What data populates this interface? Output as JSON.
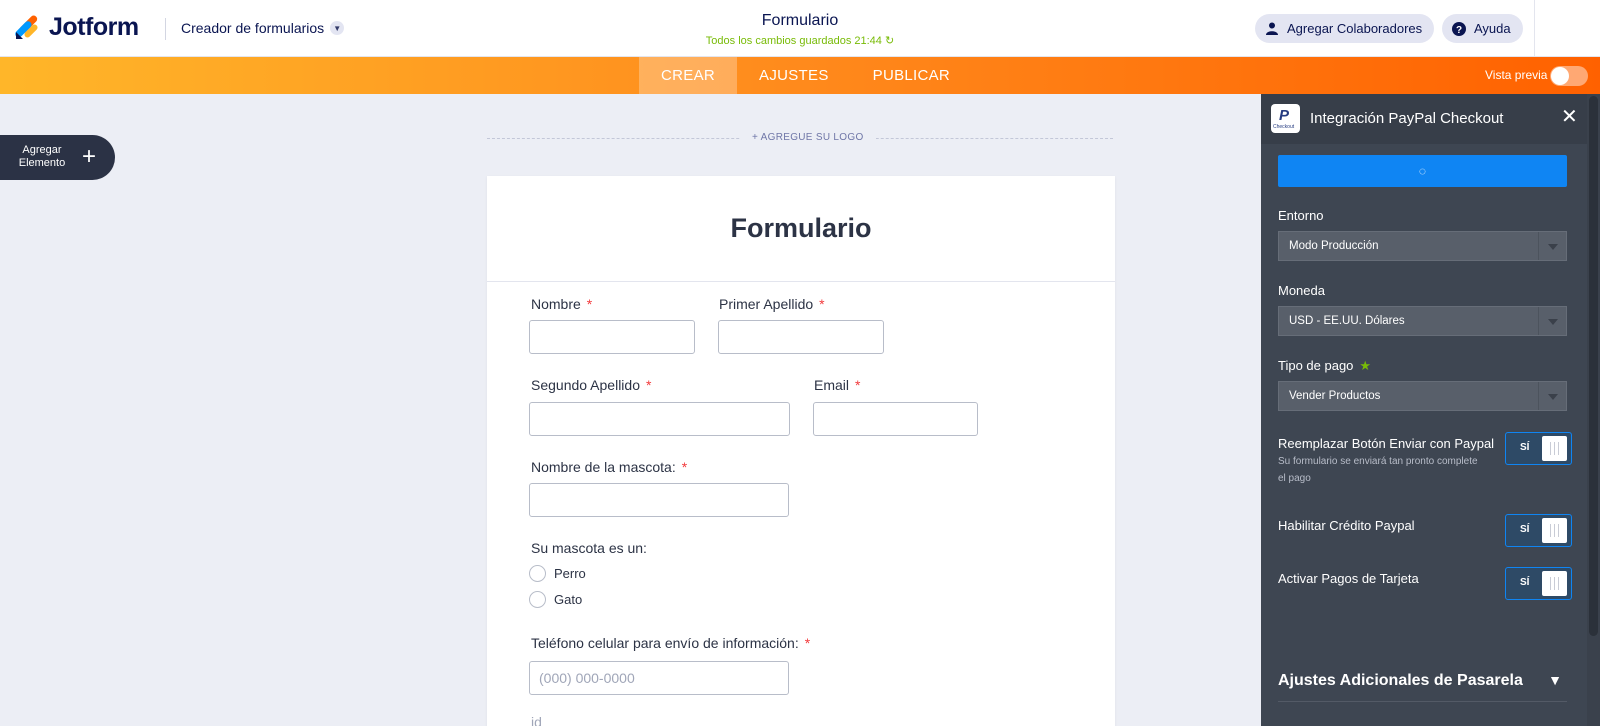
{
  "header": {
    "brand": "Jotform",
    "creator": "Creador de formularios",
    "title": "Formulario",
    "saved_status": "Todos los cambios guardados 21:44",
    "collab_label": "Agregar Colaboradores",
    "help_label": "Ayuda"
  },
  "nav": {
    "tabs": [
      {
        "label": "CREAR",
        "active": true
      },
      {
        "label": "AJUSTES",
        "active": false
      },
      {
        "label": "PUBLICAR",
        "active": false
      }
    ],
    "preview_label": "Vista previa"
  },
  "add_element": {
    "label_line1": "Agregar",
    "label_line2": "Elemento"
  },
  "logo_placeholder": "+ AGREGUE SU LOGO",
  "form": {
    "heading": "Formulario",
    "fields": {
      "nombre": "Nombre",
      "primer_apellido": "Primer Apellido",
      "segundo_apellido": "Segundo Apellido",
      "email": "Email",
      "mascota": "Nombre de la mascota:",
      "tipo_mascota": "Su mascota es un:",
      "telefono": "Teléfono celular para envío de información:",
      "telefono_placeholder": "(000) 000-0000",
      "id": "id"
    },
    "required_mark": "*",
    "pet_options": [
      "Perro",
      "Gato"
    ]
  },
  "panel": {
    "title": "Integración PayPal Checkout",
    "logo_sub": "Checkout",
    "button_label": "...",
    "entorno": {
      "label": "Entorno",
      "value": "Modo Producción"
    },
    "moneda": {
      "label": "Moneda",
      "value": "USD - EE.UU. Dólares"
    },
    "tipo_pago": {
      "label": "Tipo de pago",
      "value": "Vender Productos",
      "star": "★"
    },
    "reemplazar": {
      "label": "Reemplazar Botón Enviar con Paypal",
      "desc": "Su formulario se enviará tan pronto complete el pago",
      "toggle": "SÍ"
    },
    "credito": {
      "label": "Habilitar Crédito Paypal",
      "toggle": "SÍ"
    },
    "tarjeta": {
      "label": "Activar Pagos de Tarjeta",
      "toggle": "SÍ"
    },
    "additional": "Ajustes Adicionales de Pasarela"
  },
  "colors": {
    "accent_orange": "#ff8a1c",
    "panel_bg": "#3e4652",
    "primary_blue": "#0f85f3",
    "required_red": "#f23a3c",
    "saved_green": "#78bb07"
  }
}
